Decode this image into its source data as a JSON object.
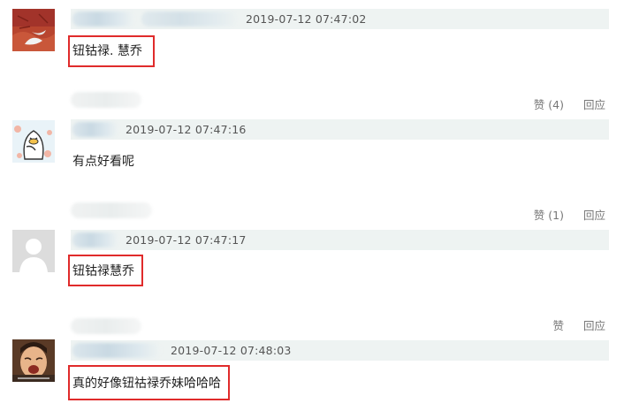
{
  "comments": [
    {
      "time": "2019-07-12 07:47:02",
      "text": "钮钴禄. 慧乔",
      "avatar_icon": "feather-photo-avatar-icon",
      "highlighted": true
    },
    {
      "time": "2019-07-12 07:47:16",
      "text": "有点好看呢",
      "avatar_icon": "cartoon-duck-avatar-icon",
      "highlighted": false
    },
    {
      "time": "2019-07-12 07:47:17",
      "text": "钮钴禄慧乔",
      "avatar_icon": "default-user-avatar-icon",
      "highlighted": true
    },
    {
      "time": "2019-07-12 07:48:03",
      "text": "真的好像钮祜禄乔妹哈哈哈",
      "avatar_icon": "crying-meme-avatar-icon",
      "highlighted": true
    }
  ],
  "actions": [
    {
      "like_label": "赞",
      "like_count": "(4)",
      "reply_label": "回应"
    },
    {
      "like_label": "赞",
      "like_count": "(1)",
      "reply_label": "回应"
    },
    {
      "like_label": "赞",
      "like_count": "",
      "reply_label": "回应"
    }
  ],
  "colors": {
    "highlight_border": "#e02b2b",
    "meta_bar_bg": "#eef3f2",
    "muted_text": "#777777"
  }
}
